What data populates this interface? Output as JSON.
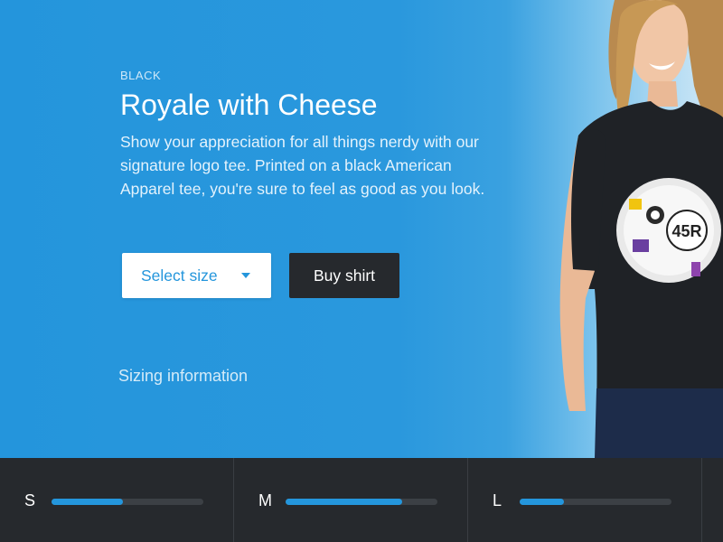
{
  "product": {
    "color_label": "BLACK",
    "title": "Royale with Cheese",
    "description": "Show your appreciation for all things nerdy with our signature logo tee. Printed on a black American Apparel tee, you're sure to feel as good as you look.",
    "select_size_label": "Select size",
    "buy_label": "Buy shirt",
    "sizing_link": "Sizing information",
    "shirt_logo_text": "45R"
  },
  "sizes": [
    {
      "label": "S",
      "fill": 0.47
    },
    {
      "label": "M",
      "fill": 0.77
    },
    {
      "label": "L",
      "fill": 0.29
    }
  ],
  "colors": {
    "accent": "#2496dc",
    "dark": "#26292d"
  }
}
